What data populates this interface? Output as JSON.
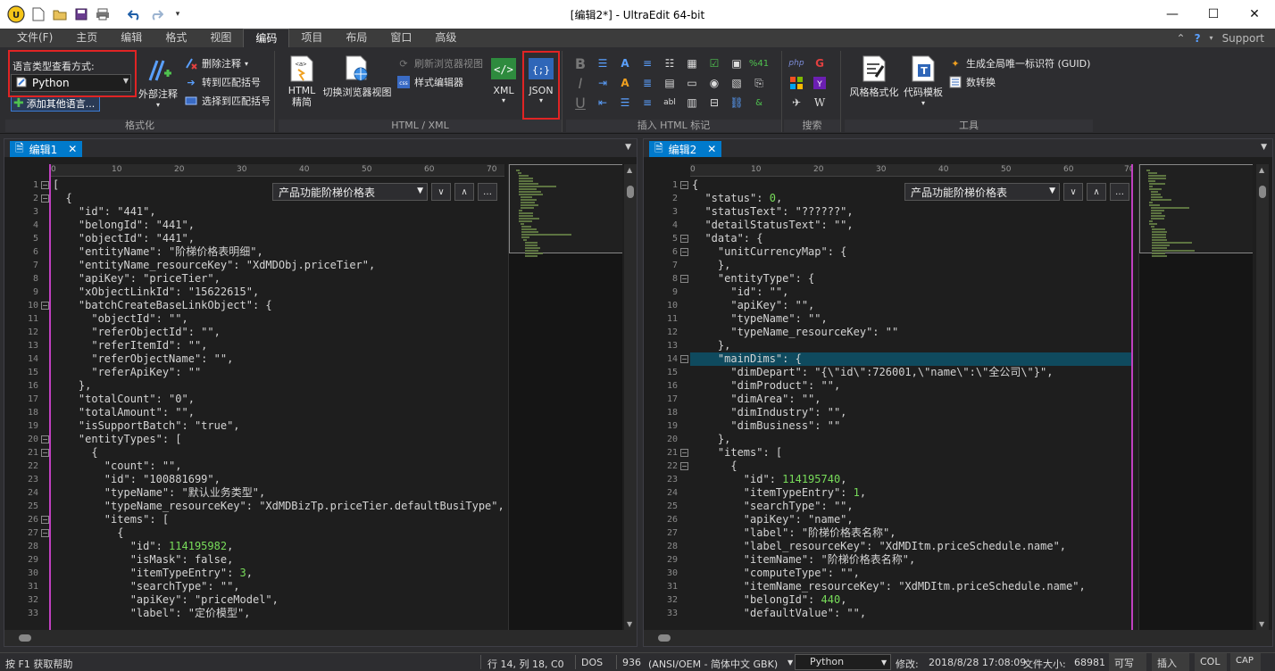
{
  "window": {
    "title": "[编辑2*] - UltraEdit 64-bit"
  },
  "ribbon_tabs": [
    "文件(F)",
    "主页",
    "编辑",
    "格式",
    "视图",
    "编码",
    "项目",
    "布局",
    "窗口",
    "高级"
  ],
  "ribbon_right": {
    "help": "?",
    "support": "Support"
  },
  "groups": {
    "format": {
      "label": "格式化",
      "lang_label": "语言类型查看方式:",
      "lang_value": "Python",
      "add_lang": "添加其他语言...",
      "comment_label": "外部注释",
      "delete_comment": "删除注释",
      "goto_match": "转到匹配括号",
      "select_match": "选择到匹配括号"
    },
    "html": {
      "label": "HTML / XML",
      "html_tidy": "HTML\n精简",
      "browser_view": "切换浏览器视图",
      "refresh_browser": "刷新浏览器视图",
      "style_editor": "样式编辑器",
      "xml": "XML",
      "json": "JSON"
    },
    "insert": {
      "label": "插入 HTML 标记"
    },
    "search": {
      "label": "搜索"
    },
    "tools": {
      "label": "工具",
      "style_format": "风格格式化",
      "code_template": "代码模板",
      "guid": "生成全局唯一标识符 (GUID)",
      "num_convert": "数转换"
    }
  },
  "left_pane": {
    "tab": "编辑1",
    "function": "产品功能阶梯价格表",
    "lines": [
      "[",
      "  {",
      "    \"id\": \"441\",",
      "    \"belongId\": \"441\",",
      "    \"objectId\": \"441\",",
      "    \"entityName\": \"阶梯价格表明细\",",
      "    \"entityName_resourceKey\": \"XdMDObj.priceTier\",",
      "    \"apiKey\": \"priceTier\",",
      "    \"xObjectLinkId\": \"15622615\",",
      "    \"batchCreateBaseLinkObject\": {",
      "      \"objectId\": \"\",",
      "      \"referObjectId\": \"\",",
      "      \"referItemId\": \"\",",
      "      \"referObjectName\": \"\",",
      "      \"referApiKey\": \"\"",
      "    },",
      "    \"totalCount\": \"0\",",
      "    \"totalAmount\": \"\",",
      "    \"isSupportBatch\": \"true\",",
      "    \"entityTypes\": [",
      "      {",
      "        \"count\": \"\",",
      "        \"id\": \"100881699\",",
      "        \"typeName\": \"默认业务类型\",",
      "        \"typeName_resourceKey\": \"XdMDBizTp.priceTier.defaultBusiType\",",
      "        \"items\": [",
      "          {",
      "            \"id\": 114195982,",
      "            \"isMask\": false,",
      "            \"itemTypeEntry\": 3,",
      "            \"searchType\": \"\",",
      "            \"apiKey\": \"priceModel\",",
      "            \"label\": \"定价模型\","
    ]
  },
  "right_pane": {
    "tab": "编辑2",
    "function": "产品功能阶梯价格表",
    "lines": [
      "{",
      "  \"status\": 0,",
      "  \"statusText\": \"??????\",",
      "  \"detailStatusText\": \"\",",
      "  \"data\": {",
      "    \"unitCurrencyMap\": {",
      "    },",
      "    \"entityType\": {",
      "      \"id\": \"\",",
      "      \"apiKey\": \"\",",
      "      \"typeName\": \"\",",
      "      \"typeName_resourceKey\": \"\"",
      "    },",
      "    \"mainDims\": {",
      "      \"dimDepart\": \"{\\\"id\\\":726001,\\\"name\\\":\\\"全公司\\\"}\",",
      "      \"dimProduct\": \"\",",
      "      \"dimArea\": \"\",",
      "      \"dimIndustry\": \"\",",
      "      \"dimBusiness\": \"\"",
      "    },",
      "    \"items\": [",
      "      {",
      "        \"id\": 114195740,",
      "        \"itemTypeEntry\": 1,",
      "        \"searchType\": \"\",",
      "        \"apiKey\": \"name\",",
      "        \"label\": \"阶梯价格表名称\",",
      "        \"label_resourceKey\": \"XdMDItm.priceSchedule.name\",",
      "        \"itemName\": \"阶梯价格表名称\",",
      "        \"computeType\": \"\",",
      "        \"itemName_resourceKey\": \"XdMDItm.priceSchedule.name\",",
      "        \"belongId\": 440,",
      "        \"defaultValue\": \"\","
    ]
  },
  "ruler_marks": [
    "0",
    "10",
    "20",
    "30",
    "40",
    "50",
    "60",
    "70"
  ],
  "status": {
    "help": "按 F1 获取帮助",
    "position": "行 14, 列 18, C0",
    "line_end": "DOS",
    "codepage": "936",
    "encoding": "(ANSI/OEM - 简体中文 GBK)",
    "language": "Python",
    "modified": "修改:",
    "modified_time": "2018/8/28 17:08:09",
    "size_label": "文件大小:",
    "size": "68981",
    "writable": "可写",
    "insert": "插入",
    "col": "COL",
    "cap": "CAP"
  }
}
